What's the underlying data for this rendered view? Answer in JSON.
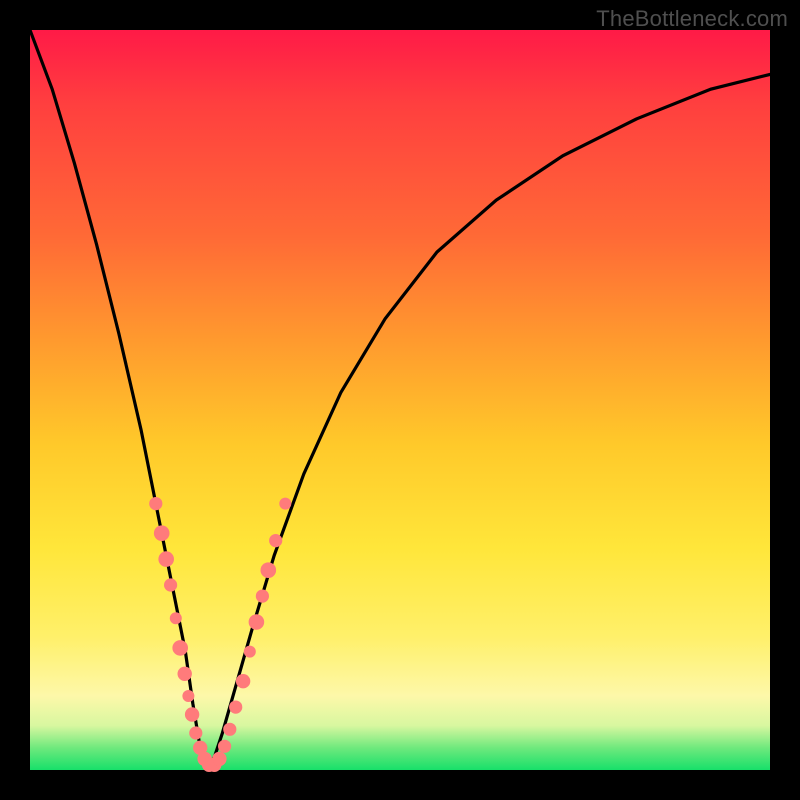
{
  "watermark": "TheBottleneck.com",
  "colors": {
    "frame": "#000000",
    "curve": "#000000",
    "markers_fill": "#ff7b7b",
    "markers_stroke": "#c94f4f"
  },
  "chart_data": {
    "type": "line",
    "title": "",
    "xlabel": "",
    "ylabel": "",
    "xlim": [
      0,
      100
    ],
    "ylim": [
      0,
      100
    ],
    "grid": false,
    "legend": false,
    "note": "Values estimated from pixels on an unlabeled plot. x is normalized 0–100 across the plot width; y is normalized 0–100 where 0 is the bottom (green) and 100 is the top (red). A single V-shaped curve dips to ~0 near x≈24 and rises asymmetrically on both sides.",
    "series": [
      {
        "name": "bottleneck-curve",
        "x": [
          0,
          3,
          6,
          9,
          12,
          15,
          17,
          19,
          21,
          22,
          23,
          24,
          25,
          26,
          28,
          30,
          33,
          37,
          42,
          48,
          55,
          63,
          72,
          82,
          92,
          100
        ],
        "y": [
          100,
          92,
          82,
          71,
          59,
          46,
          36,
          26,
          16,
          9,
          3,
          0,
          2,
          5,
          12,
          19,
          29,
          40,
          51,
          61,
          70,
          77,
          83,
          88,
          92,
          94
        ]
      }
    ],
    "markers": {
      "name": "highlighted-points",
      "note": "Pink circular markers clustered near the trough of the V on both branches.",
      "points": [
        {
          "x": 17.0,
          "y": 36.0,
          "r": 2.2
        },
        {
          "x": 17.8,
          "y": 32.0,
          "r": 2.6
        },
        {
          "x": 18.4,
          "y": 28.5,
          "r": 2.6
        },
        {
          "x": 19.0,
          "y": 25.0,
          "r": 2.2
        },
        {
          "x": 19.7,
          "y": 20.5,
          "r": 2.0
        },
        {
          "x": 20.3,
          "y": 16.5,
          "r": 2.6
        },
        {
          "x": 20.9,
          "y": 13.0,
          "r": 2.4
        },
        {
          "x": 21.4,
          "y": 10.0,
          "r": 2.0
        },
        {
          "x": 21.9,
          "y": 7.5,
          "r": 2.4
        },
        {
          "x": 22.4,
          "y": 5.0,
          "r": 2.2
        },
        {
          "x": 23.0,
          "y": 3.0,
          "r": 2.4
        },
        {
          "x": 23.6,
          "y": 1.5,
          "r": 2.4
        },
        {
          "x": 24.2,
          "y": 0.7,
          "r": 2.4
        },
        {
          "x": 24.9,
          "y": 0.7,
          "r": 2.4
        },
        {
          "x": 25.6,
          "y": 1.5,
          "r": 2.4
        },
        {
          "x": 26.3,
          "y": 3.2,
          "r": 2.2
        },
        {
          "x": 27.0,
          "y": 5.5,
          "r": 2.2
        },
        {
          "x": 27.8,
          "y": 8.5,
          "r": 2.2
        },
        {
          "x": 28.8,
          "y": 12.0,
          "r": 2.4
        },
        {
          "x": 29.7,
          "y": 16.0,
          "r": 2.0
        },
        {
          "x": 30.6,
          "y": 20.0,
          "r": 2.6
        },
        {
          "x": 31.4,
          "y": 23.5,
          "r": 2.2
        },
        {
          "x": 32.2,
          "y": 27.0,
          "r": 2.6
        },
        {
          "x": 33.2,
          "y": 31.0,
          "r": 2.2
        },
        {
          "x": 34.5,
          "y": 36.0,
          "r": 2.0
        }
      ]
    }
  }
}
